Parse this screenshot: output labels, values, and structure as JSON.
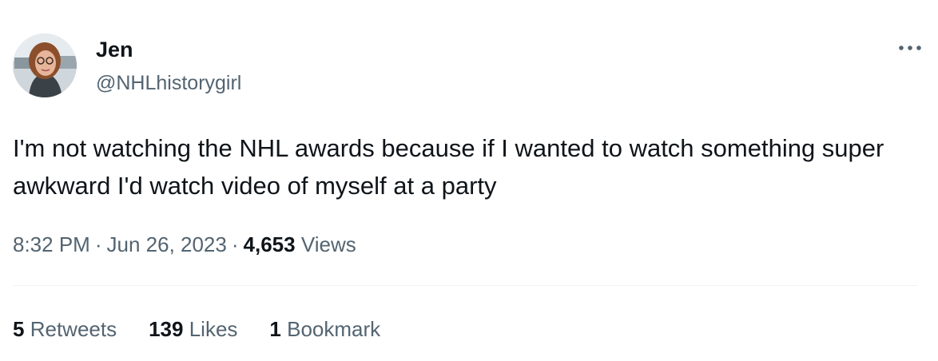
{
  "user": {
    "name": "Jen",
    "handle": "@NHLhistorygirl"
  },
  "tweet": {
    "text": "I'm not watching the NHL awards because if I wanted to watch something super awkward I'd watch video of myself at a party",
    "time": "8:32 PM",
    "date": "Jun 26, 2023",
    "separator": "·",
    "views_count": "4,653",
    "views_label": "Views"
  },
  "stats": {
    "retweets_count": "5",
    "retweets_label": "Retweets",
    "likes_count": "139",
    "likes_label": "Likes",
    "bookmarks_count": "1",
    "bookmarks_label": "Bookmark"
  },
  "icons": {
    "more": "more-horizontal-icon"
  },
  "colors": {
    "primary_text": "#0f1419",
    "secondary_text": "#536471",
    "divider": "#eff3f4"
  }
}
